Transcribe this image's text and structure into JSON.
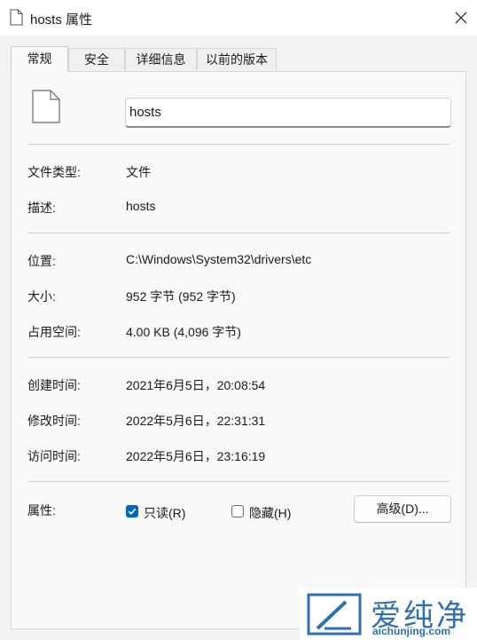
{
  "window": {
    "title": "hosts 属性"
  },
  "tabs": [
    {
      "label": "常规",
      "active": true
    },
    {
      "label": "安全",
      "active": false
    },
    {
      "label": "详细信息",
      "active": false
    },
    {
      "label": "以前的版本",
      "active": false
    }
  ],
  "file": {
    "name": "hosts"
  },
  "fields": {
    "type": {
      "label": "文件类型:",
      "value": "文件"
    },
    "desc": {
      "label": "描述:",
      "value": "hosts"
    },
    "location": {
      "label": "位置:",
      "value": "C:\\Windows\\System32\\drivers\\etc"
    },
    "size": {
      "label": "大小:",
      "value": "952 字节 (952 字节)"
    },
    "disk": {
      "label": "占用空间:",
      "value": "4.00 KB (4,096 字节)"
    },
    "created": {
      "label": "创建时间:",
      "value": "2021年6月5日，20:08:54"
    },
    "modified": {
      "label": "修改时间:",
      "value": "2022年5月6日，22:31:31"
    },
    "accessed": {
      "label": "访问时间:",
      "value": "2022年5月6日，23:16:19"
    }
  },
  "attributes": {
    "label": "属性:",
    "readonly": {
      "label": "只读(R)",
      "checked": true
    },
    "hidden": {
      "label": "隐藏(H)",
      "checked": false
    },
    "advanced_label": "高级(D)..."
  },
  "watermark": {
    "brand": "爱纯净",
    "url": "aichunjing.com"
  },
  "colors": {
    "accent": "#0067c0",
    "watermark": "#2f6fb4"
  }
}
